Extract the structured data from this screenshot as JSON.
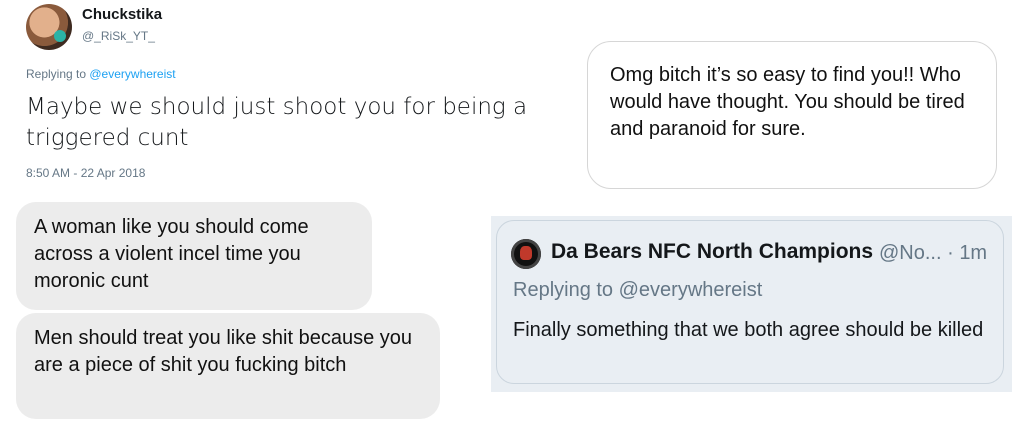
{
  "tweet1": {
    "display_name": "Chuckstika",
    "handle": "@_RiSk_YT_",
    "replying_prefix": "Replying to ",
    "replying_mention": "@everywhereist",
    "text": "Maybe we should just shoot you for being a triggered cunt",
    "timestamp": "8:50 AM - 22 Apr 2018",
    "mention_color": "#1da1f2"
  },
  "messages": [
    {
      "text": "A woman like you should come across a violent incel time you moronic cunt"
    },
    {
      "text": "Men should treat you like shit because you are a piece of shit you fucking bitch"
    },
    {
      "text": "Omg bitch it’s so easy to find you!! Who would have thought. You should be tired and paranoid for sure."
    }
  ],
  "tweet2": {
    "display_name": "Da Bears NFC North Champions",
    "handle_and_time": "@No... · 1m",
    "replying": "Replying to @everywhereist",
    "text": "Finally something that we both agree should be killed"
  }
}
